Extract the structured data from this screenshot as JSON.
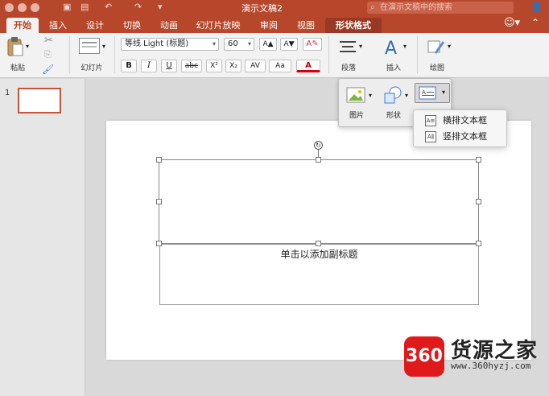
{
  "titlebar": {
    "doc_title": "演示文稿2",
    "search_placeholder": "在演示文稿中的搜索"
  },
  "tabs": [
    "开始",
    "插入",
    "设计",
    "切换",
    "动画",
    "幻灯片放映",
    "审阅",
    "视图",
    "形状格式"
  ],
  "active_tab": "开始",
  "ribbon": {
    "paste_label": "粘贴",
    "slides_label": "幻灯片",
    "font_name": "等线 Light (标题)",
    "font_size": "60",
    "bold": "B",
    "italic": "I",
    "underline": "U",
    "strike": "abc",
    "superscript": "X²",
    "subscript": "X₂",
    "spacing": "AV",
    "change_case": "Aa",
    "font_color": "A",
    "grow": "A▲",
    "shrink": "A▼",
    "paragraph_label": "段落",
    "insert_label": "插入",
    "drawing_label": "绘图"
  },
  "insert_popup": {
    "picture_label": "图片",
    "shape_label": "形状"
  },
  "textbox_menu": {
    "items": [
      "横排文本框",
      "竖排文本框"
    ]
  },
  "sidebar": {
    "slide_number": "1"
  },
  "slide": {
    "subtitle_placeholder": "单击以添加副标题"
  },
  "watermark": {
    "badge": "360",
    "name": "货源之家",
    "url": "www.360hyzj.com"
  },
  "colors": {
    "brand": "#b7472a",
    "tab_format": "#993823",
    "ribbon_bg": "#f2f2f2",
    "accent_red": "#e01a1a"
  }
}
